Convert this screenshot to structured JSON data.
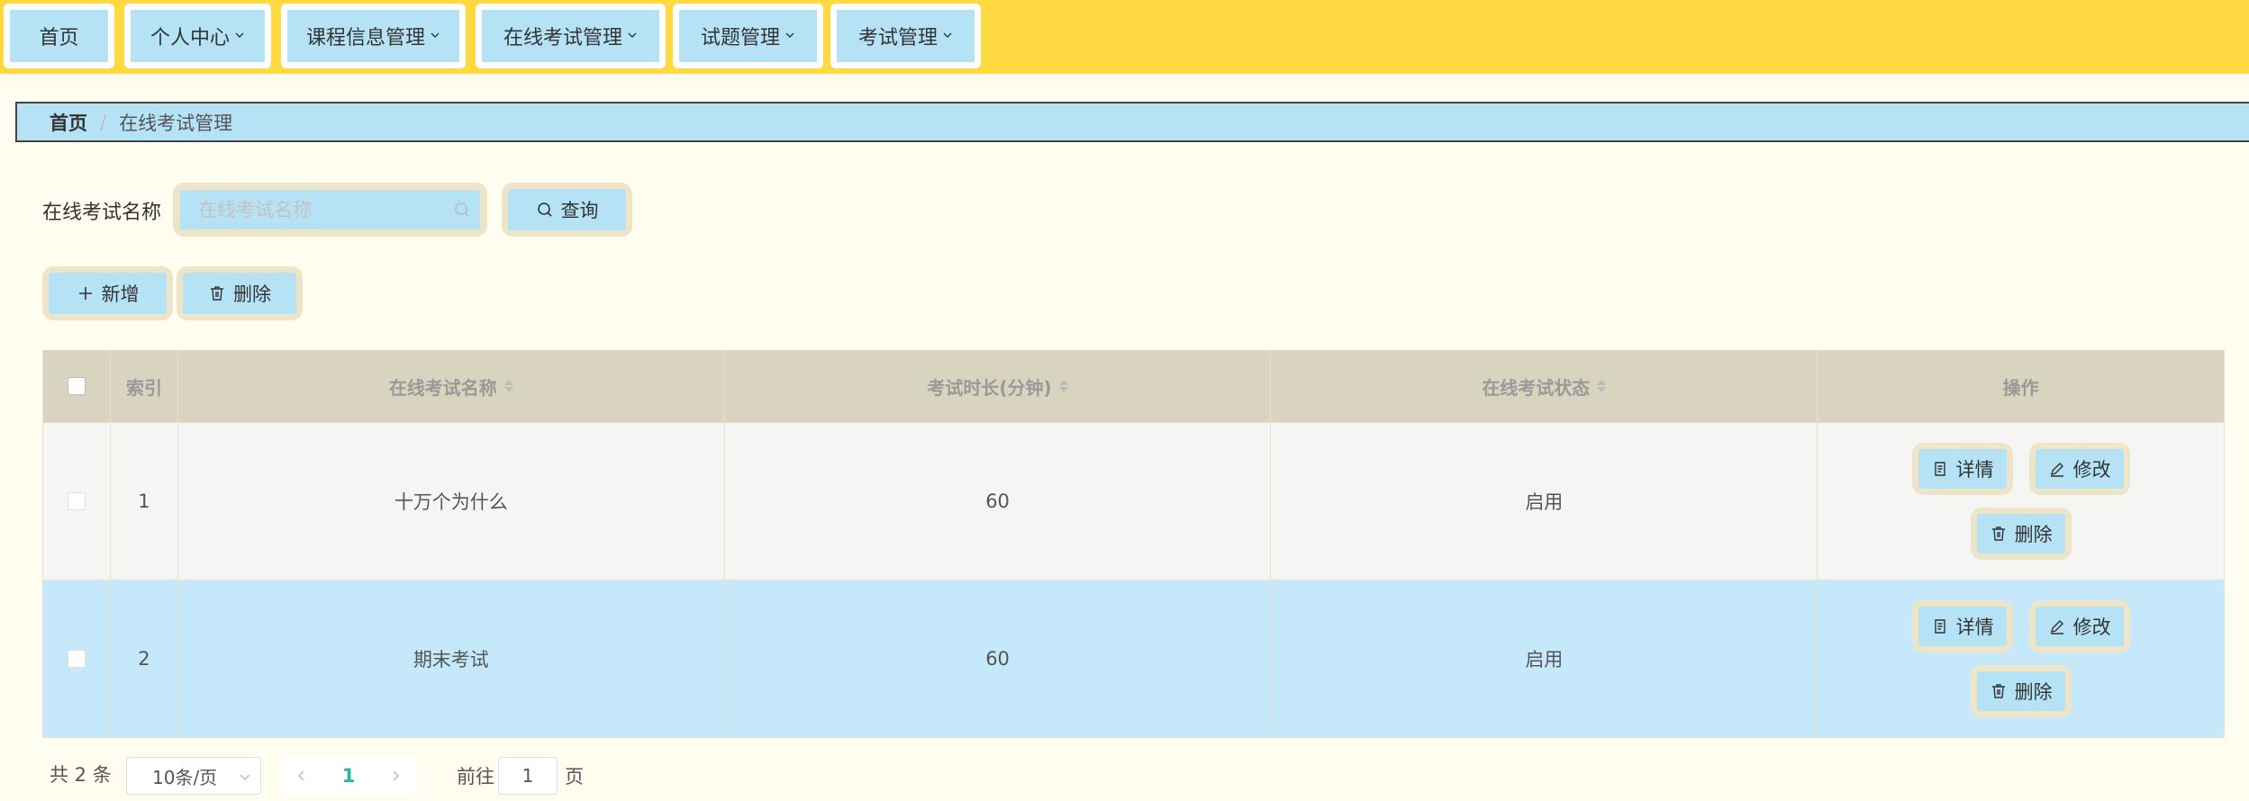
{
  "nav": [
    {
      "label": "首页",
      "dropdown": false
    },
    {
      "label": "个人中心",
      "dropdown": true
    },
    {
      "label": "课程信息管理",
      "dropdown": true
    },
    {
      "label": "在线考试管理",
      "dropdown": true
    },
    {
      "label": "试题管理",
      "dropdown": true
    },
    {
      "label": "考试管理",
      "dropdown": true
    }
  ],
  "breadcrumb": {
    "home": "首页",
    "separator": "/",
    "current": "在线考试管理"
  },
  "search": {
    "label": "在线考试名称",
    "placeholder": "在线考试名称",
    "button": "查询"
  },
  "actions": {
    "add": "新增",
    "delete": "删除"
  },
  "table": {
    "headers": {
      "index": "索引",
      "name": "在线考试名称",
      "duration": "考试时长(分钟)",
      "status": "在线考试状态",
      "ops": "操作"
    },
    "rows": [
      {
        "index": "1",
        "name": "十万个为什么",
        "duration": "60",
        "status": "启用"
      },
      {
        "index": "2",
        "name": "期末考试",
        "duration": "60",
        "status": "启用"
      }
    ],
    "op_labels": {
      "detail": "详情",
      "edit": "修改",
      "delete": "删除"
    }
  },
  "pagination": {
    "total": "共 2 条",
    "page_size": "10条/页",
    "current_page": "1",
    "goto_label": "前往",
    "goto_value": "1",
    "goto_unit": "页"
  },
  "colors": {
    "topbar": "#ffd942",
    "button_fill": "#b5e3f5",
    "button_border": "#eee5c8",
    "selected_row": "#c5e9fa",
    "page_active": "#2bb5a8"
  }
}
